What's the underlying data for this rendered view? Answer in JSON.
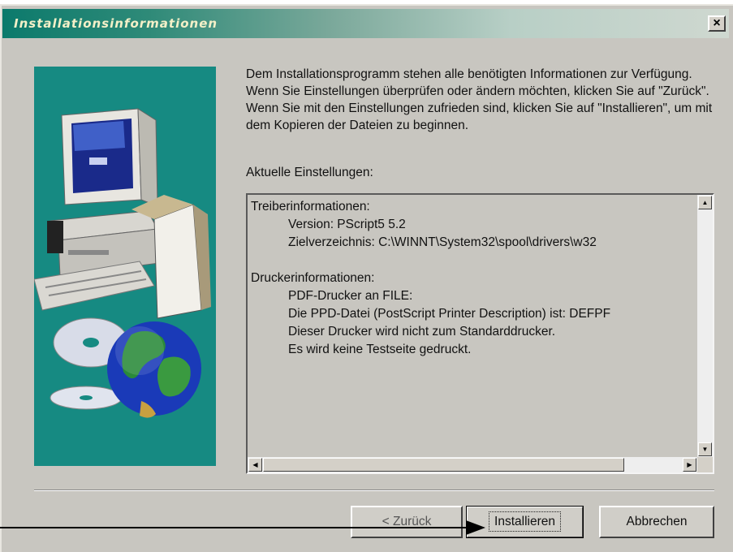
{
  "window": {
    "title": "Installationsinformationen",
    "close_glyph": "×"
  },
  "intro_text": "Dem Installationsprogramm stehen alle benötigten Informationen zur Verfügung. Wenn Sie Einstellungen überprüfen oder ändern möchten, klicken Sie auf \"Zurück\". Wenn Sie mit den Einstellungen zufrieden sind, klicken Sie auf \"Installieren\", um mit dem Kopieren der Dateien zu beginnen.",
  "current_settings_label": "Aktuelle Einstellungen:",
  "settings": {
    "driver_heading": "Treiberinformationen:",
    "driver_version": "Version: PScript5 5.2",
    "driver_target": "Zielverzeichnis: C:\\WINNT\\System32\\spool\\drivers\\w32",
    "printer_heading": "Druckerinformationen:",
    "printer_port": "PDF-Drucker an FILE:",
    "printer_ppd": "Die PPD-Datei (PostScript Printer Description) ist: DEFPF",
    "printer_default": "Dieser Drucker wird nicht zum Standarddrucker.",
    "printer_testpage": "Es wird keine Testseite gedruckt."
  },
  "buttons": {
    "back": "< Zurück",
    "install": "Installieren",
    "cancel": "Abbrechen"
  },
  "icons": {
    "illustration": [
      "computer-icon",
      "open-box-icon",
      "cd-icon",
      "globe-icon"
    ],
    "pointer": "arrow-pointer"
  },
  "colors": {
    "dialog_bg": "#c8c6c0",
    "title_start": "#0c7a6c",
    "title_end": "#cfd8d0",
    "illustration_bg": "#168a82"
  }
}
